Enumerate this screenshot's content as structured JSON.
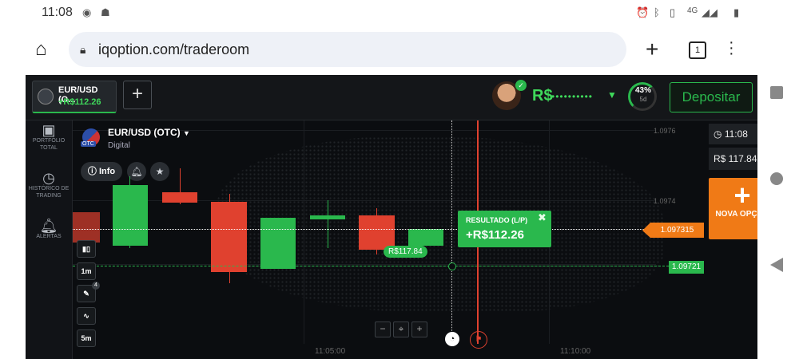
{
  "status_bar": {
    "time": "11:08",
    "network": "4G"
  },
  "browser": {
    "url": "iqoption.com/traderoom",
    "tab_count": "1"
  },
  "header": {
    "asset_tab": {
      "name": "EUR/USD (O...",
      "profit": "+R$112.26"
    },
    "add_tab_symbol": "+",
    "balance_currency": "R$",
    "balance_masked": "••••••••••",
    "level_percent": "43%",
    "level_days": "5d",
    "deposit_label": "Depositar"
  },
  "sidebar": {
    "items": [
      {
        "label": "PORTFÓLIO TOTAL",
        "icon": "briefcase-icon"
      },
      {
        "label": "HISTÓRICO DE TRADING",
        "icon": "history-icon"
      },
      {
        "label": "ALERTAS",
        "icon": "bell-icon"
      }
    ]
  },
  "chart": {
    "asset": "EUR/USD (OTC)",
    "option_type": "Digital",
    "flag_badge": "OTC",
    "info_label": "Info",
    "price_levels": [
      "1.0976",
      "1.0974"
    ],
    "time_labels": [
      "11:05:00",
      "11:10:00"
    ],
    "tools": [
      "1m",
      "5m"
    ],
    "tool_badge": "4"
  },
  "result": {
    "title": "RESULTADO (L/P)",
    "value": "+R$112.26",
    "entry_tag": "R$117.84"
  },
  "price_tags": {
    "current": "1.097315",
    "strike": "1.09721"
  },
  "right_panel": {
    "time": "11:08",
    "amount": "R$ 117.84",
    "new_option_label": "NOVA OPÇÃO"
  },
  "colors": {
    "green": "#2ab84d",
    "red": "#e0412f",
    "orange": "#f07a16",
    "bg": "#0d0f12"
  }
}
